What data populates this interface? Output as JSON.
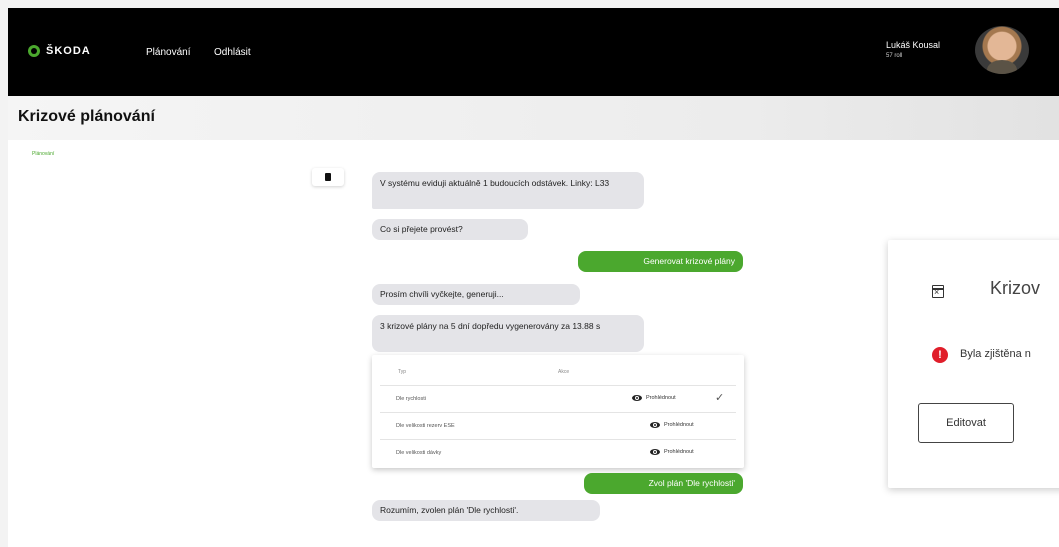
{
  "header": {
    "logo_text": "ŠKODA",
    "nav": [
      "Plánování",
      "Odhlásit"
    ],
    "user_name": "Lukáš Kousal",
    "user_sub": "57 roll"
  },
  "page": {
    "title": "Krizové plánování",
    "breadcrumb": "Plánování"
  },
  "chat": {
    "messages": [
      {
        "from": "bot",
        "text": "V systému eviduji aktuálně 1 budoucích odstávek. Linky: L33"
      },
      {
        "from": "bot",
        "text": "Co si přejete provést?"
      },
      {
        "from": "user",
        "text": "Generovat krizové plány"
      },
      {
        "from": "bot",
        "text": "Prosím chvíli vyčkejte, generuji..."
      },
      {
        "from": "bot",
        "text": "3 krizové plány na 5 dní dopředu vygenerovány za 13.88 s"
      },
      {
        "from": "user",
        "text": "Zvol plán 'Dle rychlosti'"
      },
      {
        "from": "bot",
        "text": "Rozumím, zvolen plán 'Dle rychlosti'."
      }
    ],
    "plan_table": {
      "headers": [
        "Typ",
        "Akce"
      ],
      "rows": [
        {
          "name": "Dle rychlosti",
          "action": "Prohlédnout",
          "selected": true
        },
        {
          "name": "Dle velikosti rezerv ESE",
          "action": "Prohlédnout",
          "selected": false
        },
        {
          "name": "Dle velikosti dávky",
          "action": "Prohlédnout",
          "selected": false
        }
      ]
    }
  },
  "card": {
    "title": "Krizov",
    "error_text": "Byla zjištěna n",
    "edit_label": "Editovat"
  },
  "colors": {
    "accent": "#4ba82e",
    "error": "#e01e2a",
    "topbar": "#000000"
  }
}
